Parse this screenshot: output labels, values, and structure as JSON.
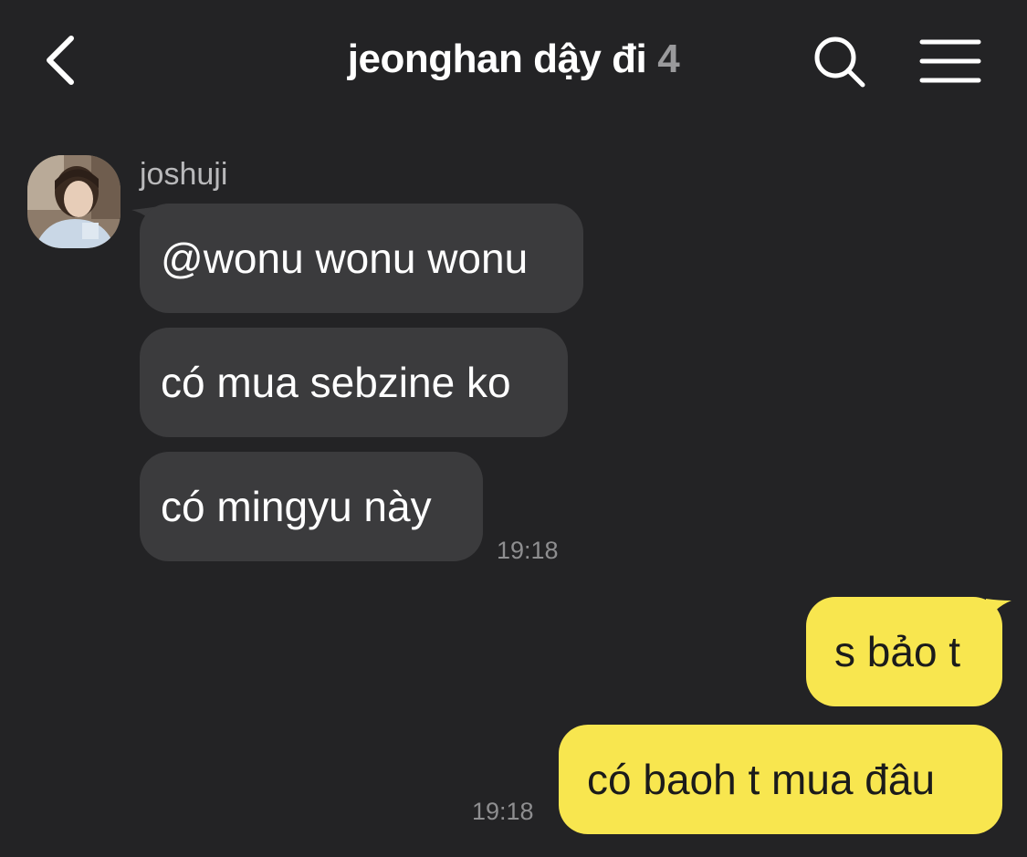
{
  "header": {
    "title": "jeonghan dậy đi",
    "member_count": "4"
  },
  "incoming": {
    "sender": "joshuji",
    "messages": [
      "@wonu wonu wonu",
      "có mua sebzine ko",
      "có mingyu này"
    ],
    "time": "19:18"
  },
  "outgoing": {
    "messages": [
      "s bảo t",
      "có baoh t mua đâu"
    ],
    "time": "19:18"
  },
  "colors": {
    "background": "#232325",
    "incoming_bubble": "#3b3b3d",
    "outgoing_bubble": "#f8e64f"
  },
  "icons": {
    "back": "chevron-left-icon",
    "search": "search-icon",
    "menu": "hamburger-menu-icon"
  }
}
